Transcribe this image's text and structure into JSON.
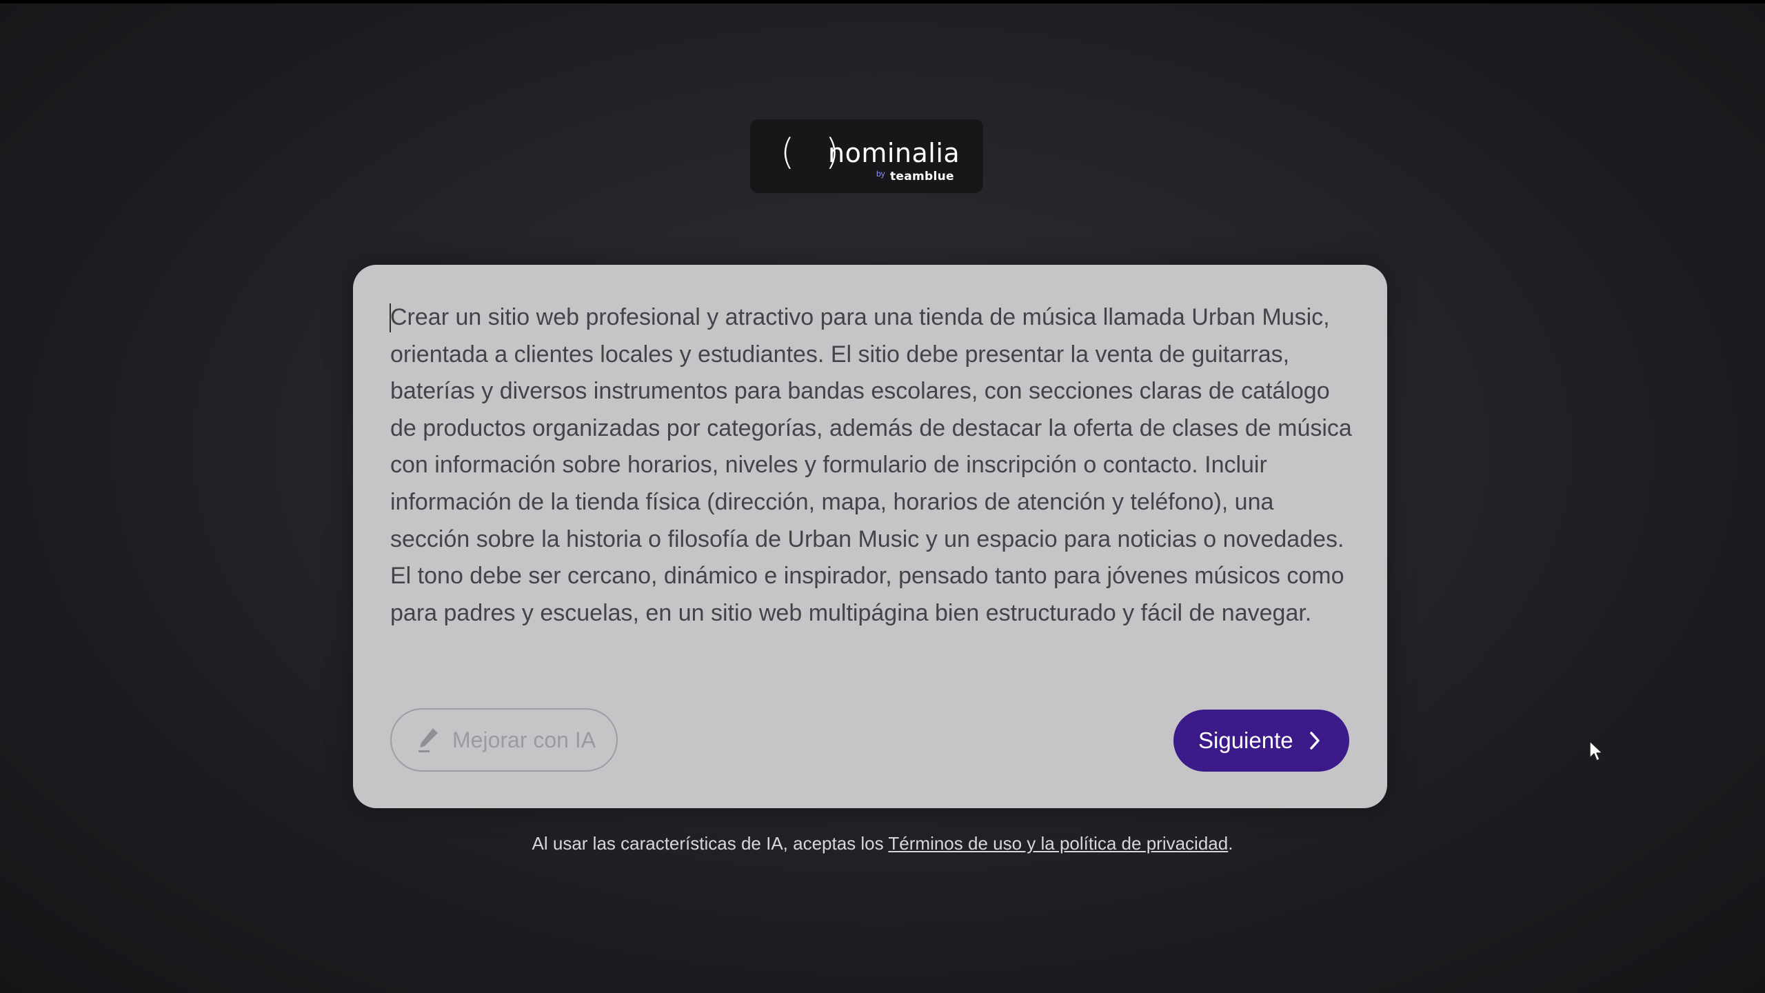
{
  "brand": {
    "parens": "( )",
    "name": "nominalia",
    "by": "by",
    "parent": "teamblue"
  },
  "prompt": {
    "text": "Crear un sitio web profesional y atractivo para una tienda de música llamada Urban Music, orientada a clientes locales y estudiantes. El sitio debe presentar la venta de guitarras, baterías y diversos instrumentos para bandas escolares, con secciones claras de catálogo de productos organizadas por categorías, además de destacar la oferta de clases de música con información sobre horarios, niveles y formulario de inscripción o contacto. Incluir información de la tienda física (dirección, mapa, horarios de atención y teléfono), una sección sobre la historia o filosofía de Urban Music y un espacio para noticias o novedades. El tono debe ser cercano, dinámico e inspirador, pensado tanto para jóvenes músicos como para padres y escuelas, en un sitio web multipágina bien estructurado y fácil de navegar."
  },
  "actions": {
    "improve_label": "Mejorar con IA",
    "improve_icon": "pencil-icon",
    "next_label": "Siguiente",
    "next_icon": "chevron-right-icon"
  },
  "footer": {
    "disclaimer_prefix": "Al usar las características de IA, aceptas los ",
    "terms_link": "Términos de uso y la política de privacidad",
    "disclaimer_suffix": "."
  },
  "colors": {
    "primary_button": "#3c1a8a",
    "card_background": "#c5c5c8",
    "page_background": "#222226"
  }
}
